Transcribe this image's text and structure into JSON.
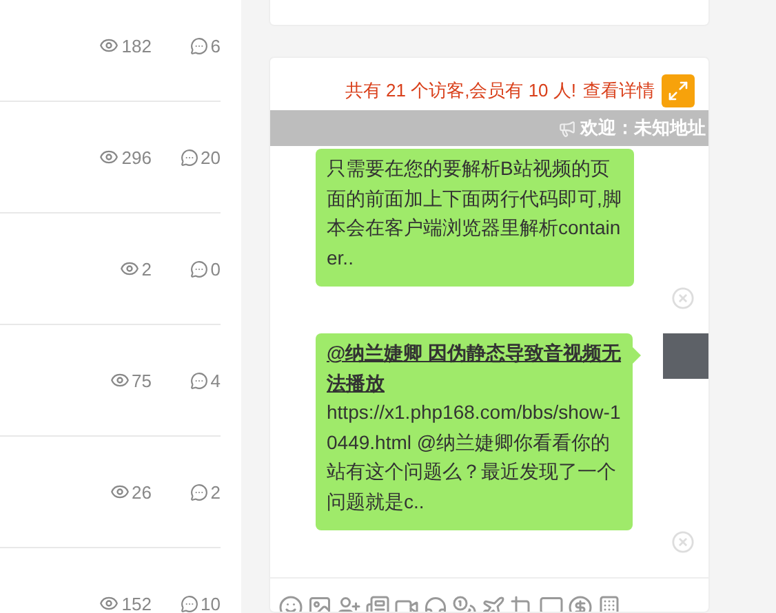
{
  "posts": [
    {
      "views": "182",
      "comments": "6"
    },
    {
      "views": "296",
      "comments": "20"
    },
    {
      "views": "2",
      "comments": "0"
    },
    {
      "views": "75",
      "comments": "4"
    },
    {
      "views": "26",
      "comments": "2"
    },
    {
      "views": "152",
      "comments": "10"
    }
  ],
  "chat": {
    "visitors_text": "共有 21 个访客,会员有 10 人!",
    "details_link": "查看详情",
    "marquee": "欢迎：未知地址",
    "messages": [
      {
        "text": "只需要在您的要解析B站视频的页面的前面加上下面两行代码即可,脚本会在客户端浏览器里解析container..",
        "has_avatar": false
      },
      {
        "title": "@纳兰婕卿 因伪静态导致音视频无法播放",
        "text": "https://x1.php168.com/bbs/show-10449.html @纳兰婕卿你看看你的站有这个问题么？最近发现了一个问题就是c..",
        "has_avatar": true
      }
    ]
  }
}
